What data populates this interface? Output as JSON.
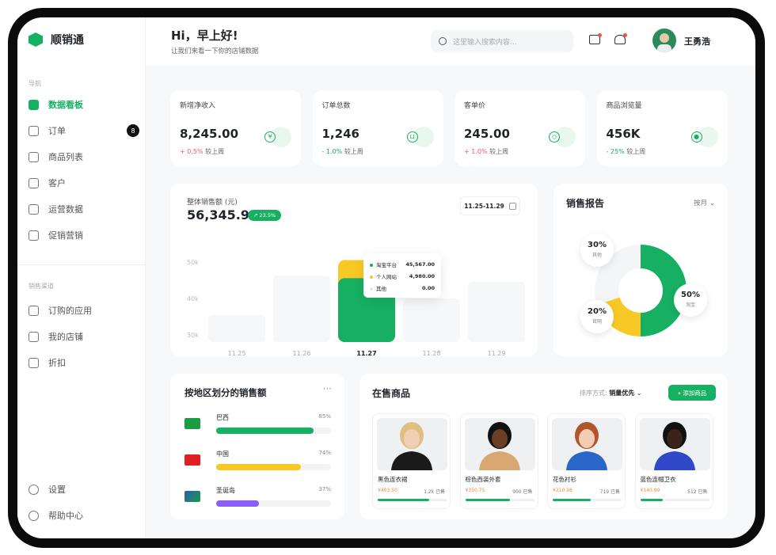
{
  "brand": "顺销通",
  "sidebar": {
    "section1": "导航",
    "items": [
      {
        "label": "数据看板",
        "icon": "home-icon"
      },
      {
        "label": "订单",
        "icon": "cart-icon",
        "badge": "8"
      },
      {
        "label": "商品列表",
        "icon": "bag-icon"
      },
      {
        "label": "客户",
        "icon": "user-icon"
      },
      {
        "label": "运营数据",
        "icon": "chart-icon"
      },
      {
        "label": "促销营销",
        "icon": "promo-icon"
      }
    ],
    "section2": "销售渠道",
    "items2": [
      {
        "label": "订购的应用",
        "icon": "apps-icon"
      },
      {
        "label": "我的店铺",
        "icon": "store-icon"
      },
      {
        "label": "折扣",
        "icon": "discount-icon"
      }
    ],
    "bottom": [
      {
        "label": "设置",
        "icon": "gear-icon"
      },
      {
        "label": "帮助中心",
        "icon": "help-icon"
      }
    ]
  },
  "header": {
    "greeting": "Hi，早上好!",
    "subtitle": "让我们来看一下你的店铺数据",
    "search_placeholder": "这里输入搜索内容...",
    "user": "王勇浩"
  },
  "kpis": [
    {
      "label": "新增净收入",
      "value": "8,245.00",
      "change": "+ 0,5%",
      "dir": "up",
      "suffix": "较上周",
      "icon": "yen-icon"
    },
    {
      "label": "订单总数",
      "value": "1,246",
      "change": "- 1.0%",
      "dir": "dn",
      "suffix": "较上周",
      "icon": "cart-icon"
    },
    {
      "label": "客单价",
      "value": "245.00",
      "change": "+ 1.0%",
      "dir": "up",
      "suffix": "较上周",
      "icon": "tag-icon"
    },
    {
      "label": "商品浏览量",
      "value": "456K",
      "change": "- 25%",
      "dir": "dn",
      "suffix": "较上周",
      "icon": "eye-icon"
    }
  ],
  "sales": {
    "title": "整体销售额 (元)",
    "total": "56,345.98",
    "growth": "23.5%",
    "date_range": "11.25-11.29"
  },
  "chart_data": [
    {
      "type": "bar",
      "categories": [
        "11.25",
        "11.26",
        "11.27",
        "11.28",
        "11.29"
      ],
      "values": [
        35500,
        46300,
        50547,
        40000,
        44600
      ],
      "highlight": "11.27",
      "yticks": [
        "30k",
        "40k",
        "50k"
      ],
      "ylim": [
        28000,
        52000
      ],
      "tooltip": [
        {
          "name": "淘宝平台",
          "value": "45,567.00",
          "color": "#17b063"
        },
        {
          "name": "个人网站",
          "value": "4,980.00",
          "color": "#f8c925"
        },
        {
          "name": "其他",
          "value": "0.00",
          "color": "#e5e7ea"
        }
      ]
    },
    {
      "type": "pie",
      "title": "销售报告",
      "period": "按月",
      "slices": [
        {
          "name": "淘宝",
          "value": 50,
          "label": "50%",
          "color": "#17b063"
        },
        {
          "name": "官网",
          "value": 20,
          "label": "20%",
          "color": "#f8c925"
        },
        {
          "name": "其他",
          "value": 30,
          "label": "30%",
          "color": "#f4f5f6"
        }
      ]
    }
  ],
  "regions": {
    "title": "按地区划分的销售额",
    "items": [
      {
        "name": "巴西",
        "pct": "85%",
        "value": 85,
        "color": "#17b063"
      },
      {
        "name": "中国",
        "pct": "74%",
        "value": 74,
        "color": "#f8c925"
      },
      {
        "name": "圣诞岛",
        "pct": "37%",
        "value": 37,
        "color": "#8b5cf6"
      }
    ]
  },
  "products": {
    "title": "在售商品",
    "sort_label": "排序方式:",
    "sort_value": "销量优先",
    "add_label": "+ 添加商品",
    "items": [
      {
        "name": "黑色连衣裙",
        "price": "¥403.50",
        "sold": "1.2k 已售",
        "progress": 75,
        "color": "#1a1a1a",
        "skin": "#f0cfb4",
        "hair": "#e0c080"
      },
      {
        "name": "棕色西装外套",
        "price": "¥350.75",
        "sold": "900 已售",
        "progress": 65,
        "color": "#d9a872",
        "skin": "#6b3e26",
        "hair": "#111"
      },
      {
        "name": "花色衬衫",
        "price": "¥210.98",
        "sold": "719 已售",
        "progress": 55,
        "color": "#2a66c8",
        "skin": "#f2cdb4",
        "hair": "#b0552d"
      },
      {
        "name": "蓝色连帽卫衣",
        "price": "¥140.99",
        "sold": "512 已售",
        "progress": 33,
        "color": "#2f49c9",
        "skin": "#3a2418",
        "hair": "#111"
      }
    ]
  }
}
